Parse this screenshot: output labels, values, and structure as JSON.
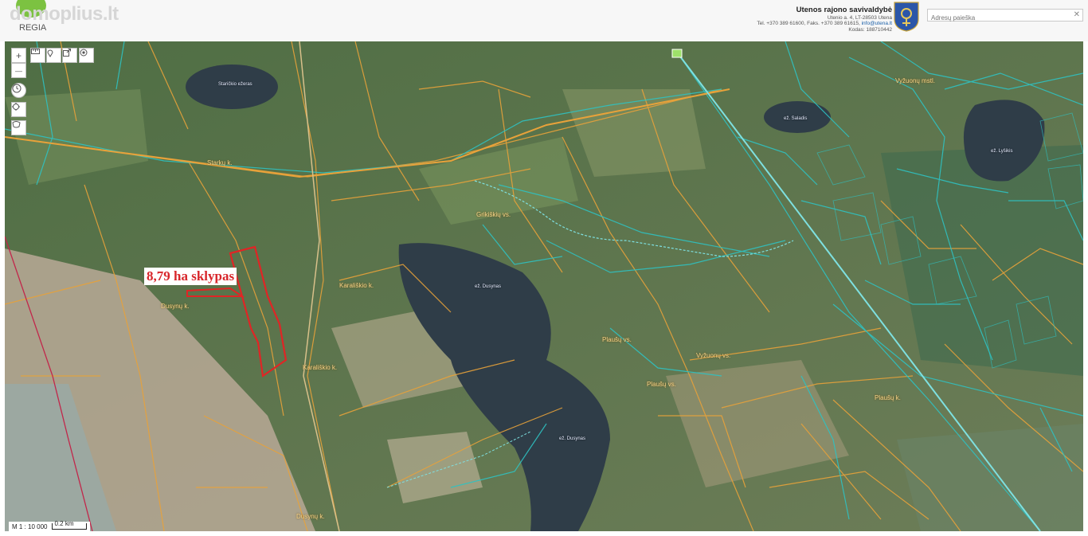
{
  "brand": {
    "logo_text": "domoplius.lt",
    "logo_sub": "REGIA"
  },
  "municipality": {
    "name": "Utenos rajono savivaldybė",
    "address": "Utenio a. 4, LT-28503 Utena",
    "phone": "Tel. +370 389 61600, Faks. +370 389 61615,",
    "email": "info@utena.lt",
    "code": "Kodas: 188710442"
  },
  "search": {
    "placeholder": "Adresų paieška",
    "clear_icon": "close-icon"
  },
  "toolbar": {
    "zoom_in": "+",
    "zoom_out": "—",
    "tools": [
      "ruler-icon",
      "pin-icon",
      "export-icon",
      "locate-icon"
    ],
    "extra": [
      "history-icon",
      "fullscreen-icon",
      "layers-icon"
    ]
  },
  "map": {
    "plot_label": "8,79 ha sklypas",
    "place_labels": [
      {
        "text": "Staričkio ežeras",
        "kind": "lake"
      },
      {
        "text": "Starkų k.",
        "kind": "village"
      },
      {
        "text": "Dusynų k.",
        "kind": "village"
      },
      {
        "text": "Karališkio k.",
        "kind": "village"
      },
      {
        "text": "Karališkio k.",
        "kind": "village"
      },
      {
        "text": "ež. Dusynas",
        "kind": "lake"
      },
      {
        "text": "ež. Dusynas",
        "kind": "lake"
      },
      {
        "text": "ež. Saladis",
        "kind": "lake"
      },
      {
        "text": "ež. Lyšikis",
        "kind": "lake"
      },
      {
        "text": "Vyžuonų mstl.",
        "kind": "village"
      },
      {
        "text": "Plaušų vs.",
        "kind": "village"
      },
      {
        "text": "Plaušų vs.",
        "kind": "village"
      },
      {
        "text": "Vyžuonų vs.",
        "kind": "village"
      },
      {
        "text": "Plaušų k.",
        "kind": "village"
      },
      {
        "text": "Dusynų k.",
        "kind": "village"
      },
      {
        "text": "Grikiškių vs.",
        "kind": "village"
      }
    ],
    "colors": {
      "parcel_orange": "#e8a23a",
      "parcel_teal": "#2fc2c2",
      "plot_red": "#e02525",
      "water": "#2f3d48"
    }
  },
  "scale": {
    "ratio": "M 1 : 10 000",
    "distance": "0.2 km"
  }
}
